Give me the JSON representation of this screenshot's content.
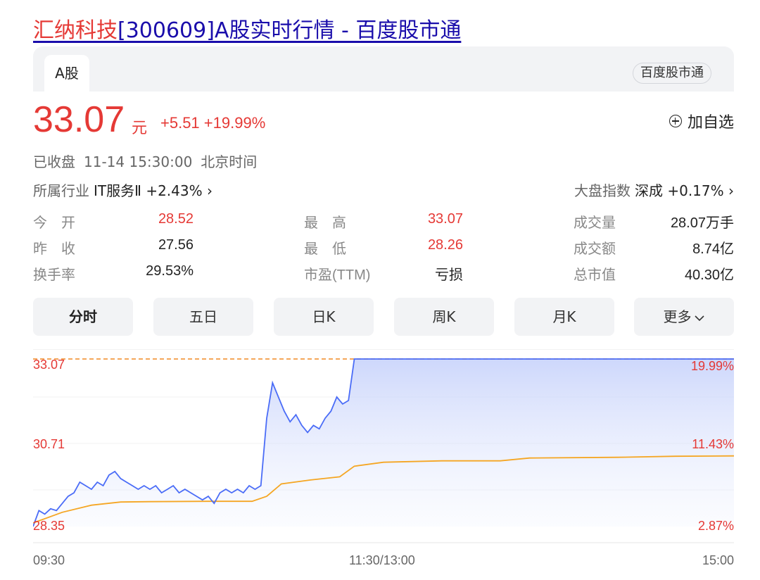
{
  "page_title": {
    "stock_name": "汇纳科技",
    "rest": "[300609]A股实时行情 - 百度股市通"
  },
  "tabs": {
    "active": "A股",
    "brand": "百度股市通"
  },
  "quote": {
    "price": "33.07",
    "unit": "元",
    "change": "+5.51",
    "change_pct": "+19.99%"
  },
  "watchlist_label": "加自选",
  "status": {
    "state": "已收盘",
    "time": "11-14 15:30:00",
    "zone": "北京时间"
  },
  "industry": {
    "label": "所属行业",
    "value": "IT服务Ⅱ +2.43% ›"
  },
  "market_index": {
    "label": "大盘指数",
    "value": "深成 +0.17% ›"
  },
  "stats": {
    "open_label": "今　开",
    "open": "28.52",
    "high_label": "最　高",
    "high": "33.07",
    "volume_label": "成交量",
    "volume": "28.07万手",
    "prev_close_label": "昨　收",
    "prev_close": "27.56",
    "low_label": "最　低",
    "low": "28.26",
    "amount_label": "成交额",
    "amount": "8.74亿",
    "turnover_label": "换手率",
    "turnover": "29.53%",
    "pe_label": "市盈(TTM)",
    "pe": "亏损",
    "mktcap_label": "总市值",
    "mktcap": "40.30亿"
  },
  "period_buttons": [
    "分时",
    "五日",
    "日K",
    "周K",
    "月K",
    "更多"
  ],
  "chart": {
    "y_left": [
      "33.07",
      "30.71",
      "28.35"
    ],
    "y_right": [
      "19.99%",
      "11.43%",
      "2.87%"
    ],
    "x_labels": [
      "09:30",
      "11:30/13:00",
      "15:00"
    ],
    "colors": {
      "price_line": "#4a6cf7",
      "avg_line": "#f5a623",
      "up": "#e53935",
      "limit_dash": "#f08a24"
    }
  },
  "chart_data": {
    "type": "line",
    "title": "",
    "x_range": [
      0,
      240
    ],
    "ylim": [
      28.35,
      33.07
    ],
    "series": [
      {
        "values": [
          [
            0,
            28.35
          ],
          [
            2,
            28.8
          ],
          [
            4,
            28.7
          ],
          [
            6,
            28.85
          ],
          [
            8,
            28.8
          ],
          [
            10,
            29.0
          ],
          [
            12,
            29.2
          ],
          [
            14,
            29.3
          ],
          [
            16,
            29.6
          ],
          [
            18,
            29.5
          ],
          [
            20,
            29.4
          ],
          [
            22,
            29.6
          ],
          [
            24,
            29.5
          ],
          [
            26,
            29.8
          ],
          [
            28,
            29.9
          ],
          [
            30,
            29.7
          ],
          [
            32,
            29.6
          ],
          [
            34,
            29.5
          ],
          [
            36,
            29.4
          ],
          [
            38,
            29.5
          ],
          [
            40,
            29.4
          ],
          [
            42,
            29.5
          ],
          [
            44,
            29.3
          ],
          [
            46,
            29.4
          ],
          [
            48,
            29.5
          ],
          [
            50,
            29.3
          ],
          [
            52,
            29.4
          ],
          [
            54,
            29.3
          ],
          [
            56,
            29.2
          ],
          [
            58,
            29.1
          ],
          [
            60,
            29.2
          ],
          [
            62,
            29.0
          ],
          [
            64,
            29.3
          ],
          [
            66,
            29.4
          ],
          [
            68,
            29.3
          ],
          [
            70,
            29.4
          ],
          [
            72,
            29.3
          ],
          [
            74,
            29.5
          ],
          [
            76,
            29.4
          ],
          [
            78,
            29.5
          ],
          [
            80,
            31.4
          ],
          [
            82,
            32.4
          ],
          [
            84,
            32.0
          ],
          [
            86,
            31.6
          ],
          [
            88,
            31.3
          ],
          [
            90,
            31.5
          ],
          [
            92,
            31.2
          ],
          [
            94,
            31.0
          ],
          [
            96,
            31.2
          ],
          [
            98,
            31.1
          ],
          [
            100,
            31.4
          ],
          [
            102,
            31.6
          ],
          [
            104,
            32.0
          ],
          [
            106,
            31.8
          ],
          [
            108,
            31.9
          ],
          [
            110,
            33.07
          ],
          [
            240,
            33.07
          ]
        ]
      },
      {
        "values": [
          [
            0,
            28.45
          ],
          [
            10,
            28.75
          ],
          [
            20,
            28.95
          ],
          [
            30,
            29.04
          ],
          [
            40,
            29.05
          ],
          [
            60,
            29.06
          ],
          [
            75,
            29.06
          ],
          [
            80,
            29.2
          ],
          [
            85,
            29.55
          ],
          [
            95,
            29.66
          ],
          [
            105,
            29.75
          ],
          [
            110,
            30.05
          ],
          [
            120,
            30.16
          ],
          [
            140,
            30.2
          ],
          [
            160,
            30.2
          ],
          [
            170,
            30.28
          ],
          [
            200,
            30.3
          ],
          [
            220,
            30.33
          ],
          [
            240,
            30.34
          ]
        ]
      }
    ]
  }
}
